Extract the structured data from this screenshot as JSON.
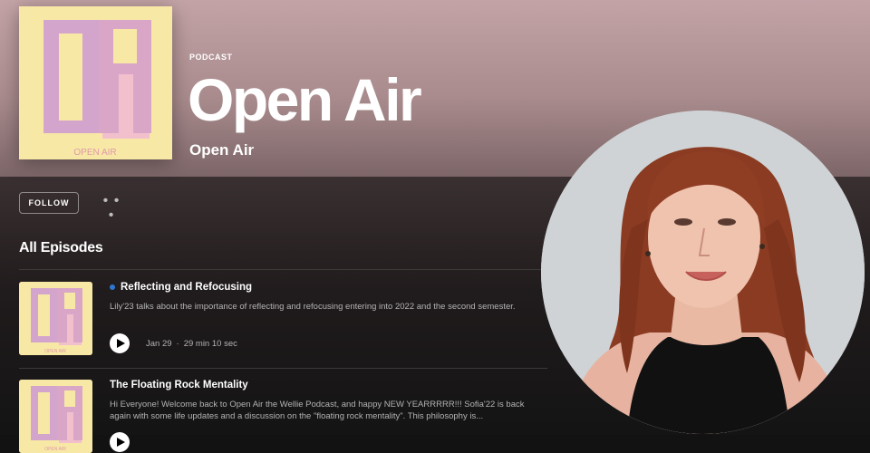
{
  "show": {
    "kind_label": "PODCAST",
    "title": "Open Air",
    "publisher": "Open Air",
    "cover_text": "OPEN AIR"
  },
  "actions": {
    "follow_label": "FOLLOW",
    "more_label": "• • •"
  },
  "episodes_section": {
    "title": "All Episodes",
    "items": [
      {
        "title": "Reflecting and Refocusing",
        "is_new": true,
        "description": "Lily'23 talks about the importance of reflecting and refocusing entering into 2022 and the second semester.",
        "date": "Jan 29",
        "separator": "·",
        "duration": "29 min 10 sec",
        "thumb_text": "OPEN AIR"
      },
      {
        "title": "The Floating Rock Mentality",
        "is_new": false,
        "description": "Hi Everyone! Welcome back to Open Air the Wellie Podcast, and happy NEW YEARRRRR!!! Sofia'22 is back again with some life updates and a discussion on the \"floating rock mentality\". This philosophy is...",
        "thumb_text": "OPEN AIR"
      }
    ]
  },
  "colors": {
    "header_top": "#c3a3a6",
    "header_bottom": "#7d6668",
    "background": "#121212",
    "cover_yellow": "#f7e8a6",
    "cover_pink": "#d9a6c8",
    "new_dot": "#2e77d0"
  },
  "icons": {
    "more": "more-dots-icon",
    "play": "play-icon"
  }
}
